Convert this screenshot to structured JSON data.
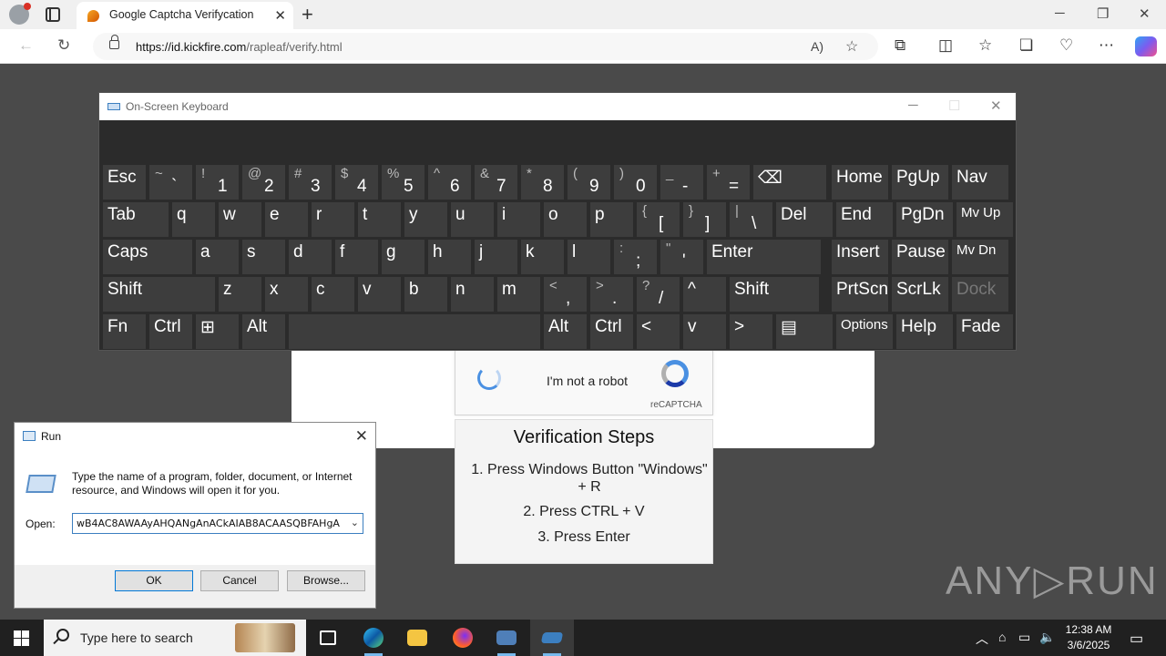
{
  "browser": {
    "tab_title": "Google Captcha Verifycation",
    "url_domain": "https://id.kickfire.com",
    "url_path": "/rapleaf/verify.html"
  },
  "captcha": {
    "label": "I'm not a robot",
    "brand": "reCAPTCHA"
  },
  "steps": {
    "title": "Verification Steps",
    "step1": "1. Press Windows Button \"Windows\" + R",
    "step2": "2. Press CTRL + V",
    "step3": "3. Press Enter"
  },
  "watermark": "ANY▷RUN",
  "osk": {
    "title": "On-Screen Keyboard",
    "rows": [
      [
        "Esc",
        "~ `",
        "! 1",
        "@ 2",
        "# 3",
        "$ 4",
        "% 5",
        "^ 6",
        "& 7",
        "* 8",
        "( 9",
        ") 0",
        "_ -",
        "+ =",
        "⌫",
        "Home",
        "PgUp",
        "Nav"
      ],
      [
        "Tab",
        "q",
        "w",
        "e",
        "r",
        "t",
        "y",
        "u",
        "i",
        "o",
        "p",
        "{ [",
        "} ]",
        "| \\",
        "Del",
        "End",
        "PgDn",
        "Mv Up"
      ],
      [
        "Caps",
        "a",
        "s",
        "d",
        "f",
        "g",
        "h",
        "j",
        "k",
        "l",
        ": ;",
        "\" '",
        "Enter",
        "Insert",
        "Pause",
        "Mv Dn"
      ],
      [
        "Shift",
        "z",
        "x",
        "c",
        "v",
        "b",
        "n",
        "m",
        "< ,",
        "> .",
        "? /",
        "^",
        "Shift",
        "PrtScn",
        "ScrLk",
        "Dock"
      ],
      [
        "Fn",
        "Ctrl",
        "⊞",
        "Alt",
        "",
        "Alt",
        "Ctrl",
        "<",
        "v",
        ">",
        "▤",
        "Options",
        "Help",
        "Fade"
      ]
    ]
  },
  "run": {
    "title": "Run",
    "description": "Type the name of a program, folder, document, or Internet resource, and Windows will open it for you.",
    "open_label": "Open:",
    "open_value": "wB4AC8AWAAyAHQANgAnACkAIAB8ACAASQBFAHgA",
    "ok": "OK",
    "cancel": "Cancel",
    "browse": "Browse..."
  },
  "taskbar": {
    "search_placeholder": "Type here to search",
    "time": "12:38 AM",
    "date": "3/6/2025"
  }
}
